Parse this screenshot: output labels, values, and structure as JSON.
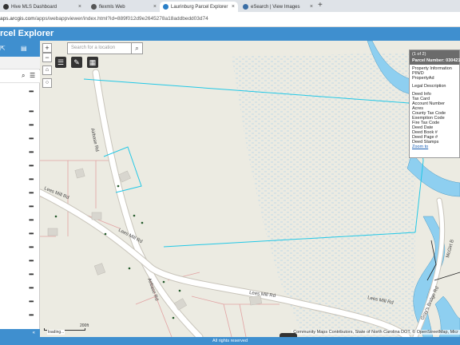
{
  "browser": {
    "tabs": [
      {
        "label": "Hive MLS Dashboard",
        "close": "×"
      },
      {
        "label": "flexmls Web",
        "close": "×"
      },
      {
        "label": "Laurinburg Parcel Explorer",
        "close": "×"
      },
      {
        "label": "eSearch | View Images",
        "close": "×"
      }
    ],
    "new_tab": "+",
    "url_host": "aps.arcgis.com",
    "url_path": "/apps/webappviewer/index.html?id=889f012d9e2645278a18addbedd03d74"
  },
  "app": {
    "title": "rcel Explorer",
    "footer": "All rights reserved",
    "panel_footer": "«"
  },
  "map": {
    "search_placeholder": "Search for a location",
    "zoom_in": "+",
    "zoom_out": "−",
    "scale_label": "200ft",
    "loading": "loading...",
    "attribution": "Community Maps Contributors, State of North Carolina DOT, © OpenStreetMap, Micr",
    "roads": {
      "airbase_upper": "Airbase Rd",
      "airbase_lower": "Airbase Rd",
      "lees_mill_left": "Lees Mill Rd",
      "lees_mill_mid": "Lees Mill Rd",
      "lees_mill_low": "Lees Mill Rd",
      "lees_mill_right": "Lees Mill Rd",
      "grays_bridge": "Gray's Bridge Rd",
      "mcgirt": "McGirt B"
    }
  },
  "popup": {
    "counter": "(1 of 2)",
    "parcel_number": "Parcel Number: 030421 0",
    "fields": [
      "Property Information",
      "PIN/D",
      "PropertyAd",
      "",
      "Legal Description",
      "",
      "Deed Info",
      "Tax Card",
      "Account Number",
      "Acres",
      "County Tax Code",
      "Exemption Code",
      "Fire Tax Code",
      "Deed Date",
      "Deed Book #",
      "Deed Page #",
      "Deed Stamps"
    ],
    "zoom_link": "Zoom to"
  },
  "colors": {
    "header_blue": "#3f8fcf",
    "parcel_cyan": "#22c8e6",
    "parcel_red": "#e2a3a3",
    "river_blue": "#8ecff0"
  }
}
